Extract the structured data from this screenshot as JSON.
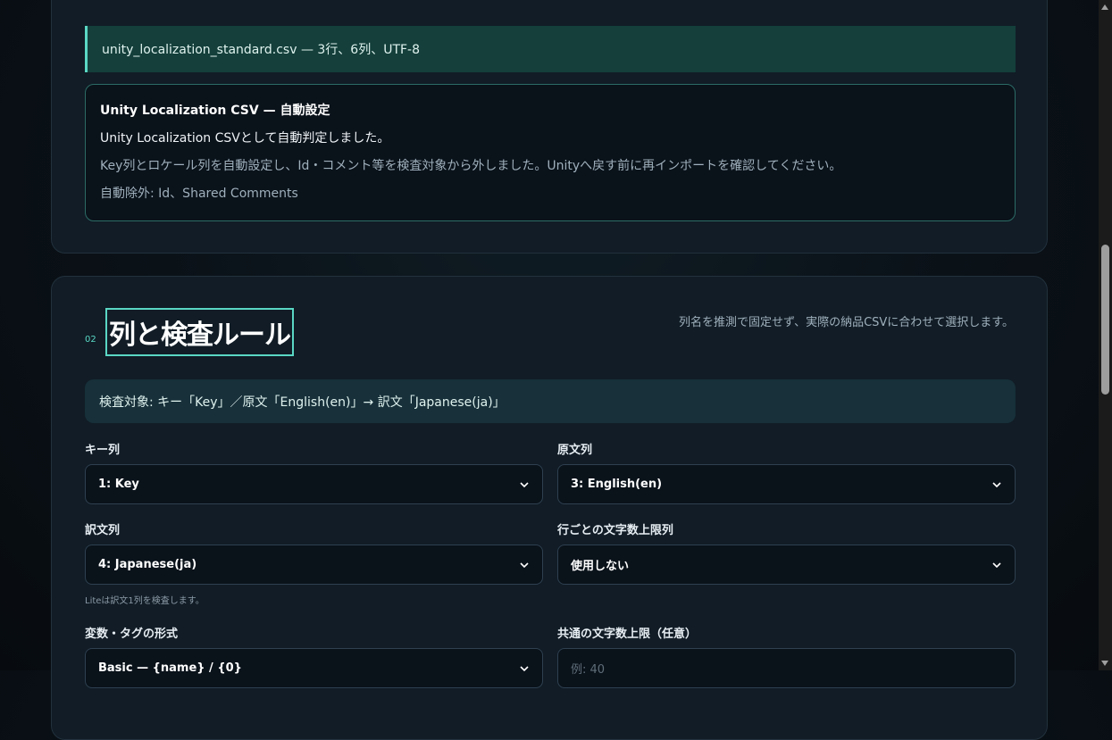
{
  "file_notice": "unity_localization_standard.csv — 3行、6列、UTF-8",
  "auto_config": {
    "title": "Unity Localization CSV — 自動設定",
    "line1": "Unity Localization CSVとして自動判定しました。",
    "line2": "Key列とロケール列を自動設定し、Id・コメント等を検査対象から外しました。Unityへ戻す前に再インポートを確認してください。",
    "line3": "自動除外: Id、Shared Comments"
  },
  "section2": {
    "number": "02",
    "title": "列と検査ルール",
    "description": "列名を推測で固定せず、実際の納品CSVに合わせて選択します。",
    "summary": "検査対象: キー「Key」／原文「English(en)」→ 訳文「Japanese(ja)」",
    "fields": {
      "key_column": {
        "label": "キー列",
        "value": "1: Key"
      },
      "source_column": {
        "label": "原文列",
        "value": "3: English(en)"
      },
      "target_column": {
        "label": "訳文列",
        "value": "4: Japanese(ja)",
        "hint": "Liteは訳文1列を検査します。"
      },
      "char_limit_column": {
        "label": "行ごとの文字数上限列",
        "value": "使用しない"
      },
      "variable_format": {
        "label": "変数・タグの形式",
        "value": "Basic — {name} / {0}"
      },
      "common_limit": {
        "label": "共通の文字数上限（任意）",
        "placeholder": "例: 40"
      }
    }
  },
  "icons": {
    "dropdown": "chevron-down-icon",
    "scroll_up": "scroll-up-arrow-icon",
    "scroll_down": "scroll-down-arrow-icon"
  },
  "colors": {
    "accent": "#5ad7c4",
    "panel_bg": "#111c26",
    "notice_bg": "#143f3b"
  }
}
